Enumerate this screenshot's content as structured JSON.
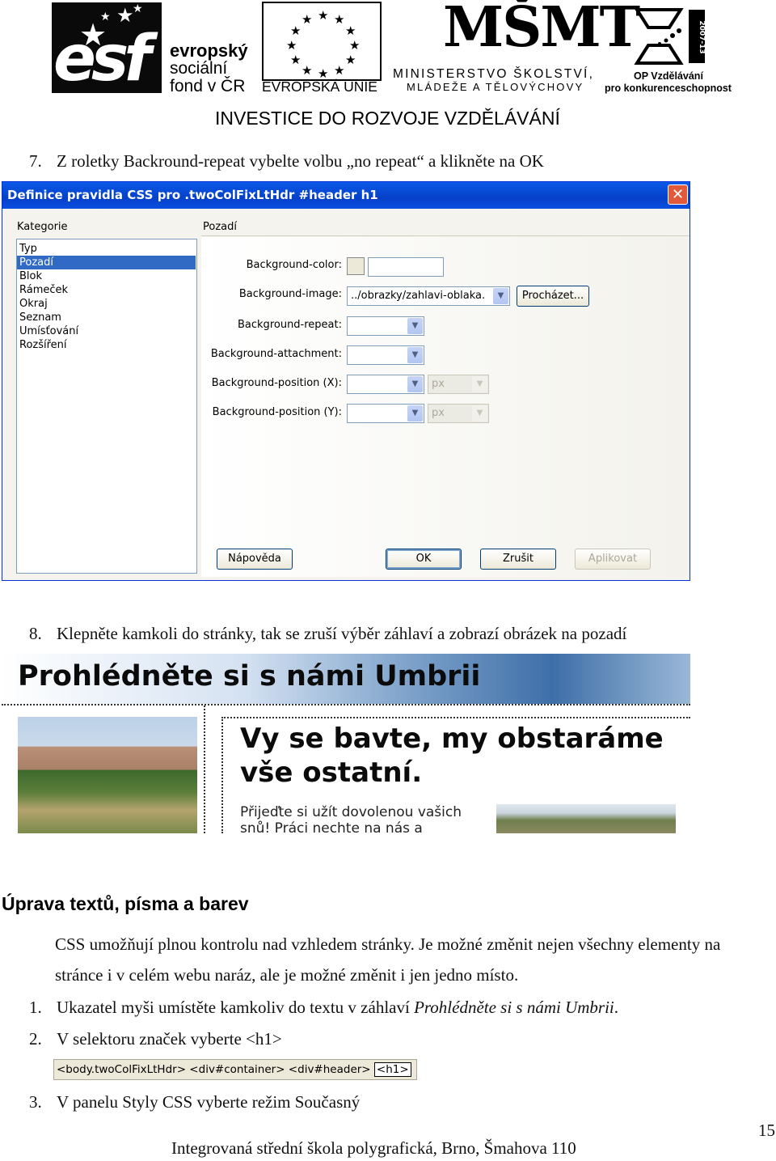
{
  "header": {
    "esf": {
      "letters": "esf",
      "line1": "evropský",
      "line2": "sociální",
      "line3": "fond v ČR"
    },
    "eu": {
      "label": "EVROPSKÁ UNIE"
    },
    "msmt": {
      "big": "MŠMT",
      "line1": "MINISTERSTVO ŠKOLSTVÍ,",
      "line2": "MLÁDEŽE A TĚLOVÝCHOVY"
    },
    "op": {
      "years": "2007-13",
      "line1": "OP Vzdělávání",
      "line2": "pro konkurenceschopnost"
    },
    "tagline": "INVESTICE DO ROZVOJE VZDĚLÁVÁNÍ"
  },
  "step7": {
    "num": "7.",
    "text": "Z roletky Backround-repeat vybelte volbu „no repeat“ a klikněte na OK"
  },
  "dialog": {
    "title": "Definice pravidla CSS pro .twoColFixLtHdr #header h1",
    "close_glyph": "✕",
    "category_label": "Kategorie",
    "panel_label": "Pozadí",
    "categories": [
      "Typ",
      "Pozadí",
      "Blok",
      "Rámeček",
      "Okraj",
      "Seznam",
      "Umísťování",
      "Rozšíření"
    ],
    "selected_category": "Pozadí",
    "fields": {
      "color_label": "Background-color:",
      "image_label": "Background-image:",
      "image_value": "../obrazky/zahlavi-oblaka.",
      "browse_button": "Procházet...",
      "repeat_label": "Background-repeat:",
      "attachment_label": "Background-attachment:",
      "posx_label": "Background-position (X):",
      "posy_label": "Background-position (Y):",
      "unit_x": "px",
      "unit_y": "px"
    },
    "buttons": {
      "help": "Nápověda",
      "ok": "OK",
      "cancel": "Zrušit",
      "apply": "Aplikovat"
    }
  },
  "step8": {
    "num": "8.",
    "text": "Klepněte kamkoli do stránky, tak se zruší výběr záhlaví a zobrazí obrázek na pozadí"
  },
  "site": {
    "header_title": "Prohlédněte si s námi Umbrii",
    "headline_line1": "Vy se bavte, my obstaráme",
    "headline_line2": "vše ostatní.",
    "para_line1": "Přijeďte si užít dovolenou vašich",
    "para_line2": "snů! Práci nechte na nás a"
  },
  "section": {
    "title": "Úprava textů, písma a barev",
    "intro_line1": "CSS umožňují plnou kontrolu nad vzhledem stránky. Je možné změnit nejen všechny elementy na",
    "intro_line2": "stránce i v celém webu naráz, ale je možné změnit i jen jedno místo."
  },
  "steps": [
    {
      "num": "1.",
      "text": "Ukazatel myši umístěte kamkoliv do textu v záhlaví ",
      "italic": "Prohlédněte si s námi Umbrii",
      "after": "."
    },
    {
      "num": "2.",
      "text": "V selektoru značek vyberte <h1>"
    },
    {
      "num": "3.",
      "text": "V panelu Styly CSS vyberte režim Současný"
    }
  ],
  "tag_selector": {
    "path": "<body.twoColFixLtHdr> <div#container> <div#header>",
    "current": "<h1>"
  },
  "footer": {
    "page_number": "15",
    "school": "Integrovaná střední škola polygrafická, Brno, Šmahova 110"
  }
}
